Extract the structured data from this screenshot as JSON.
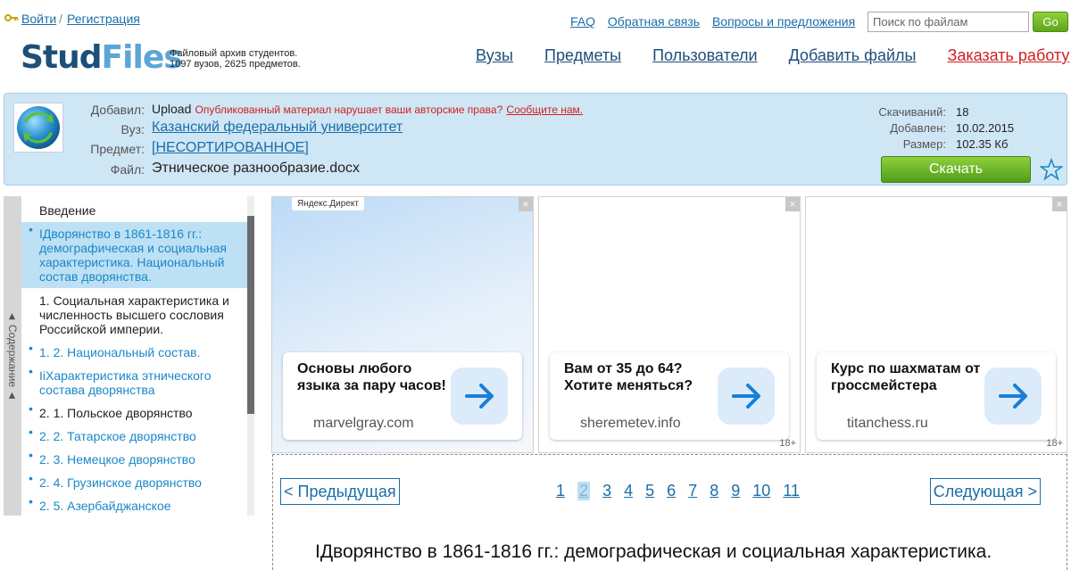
{
  "auth": {
    "login": "Войти",
    "separator": "/",
    "register": "Регистрация"
  },
  "top_links": [
    "FAQ",
    "Обратная связь",
    "Вопросы и предложения"
  ],
  "search": {
    "placeholder": "Поиск по файлам",
    "button": "Go"
  },
  "logo": {
    "part1": "Stud",
    "part2": "Files"
  },
  "tagline": {
    "line1": "Файловый архив студентов.",
    "line2": "1097 вузов, 2625 предметов."
  },
  "nav": {
    "universities": "Вузы",
    "subjects": "Предметы",
    "users": "Пользователи",
    "add_files": "Добавить файлы",
    "order": "Заказать работу"
  },
  "info": {
    "added_label": "Добавил:",
    "uploader": "Upload",
    "claim_text": "Опубликованный материал нарушает ваши авторские права?",
    "claim_link": "Сообщите нам.",
    "university_label": "Вуз:",
    "university": "Казанский федеральный университет",
    "subject_label": "Предмет:",
    "subject": "[НЕСОРТИРОВАННОЕ]",
    "file_label": "Файл:",
    "file": "Этническое разнообразие.docx"
  },
  "stats": {
    "downloads_label": "Скачиваний:",
    "downloads": "18",
    "added_label": "Добавлен:",
    "added": "10.02.2015",
    "size_label": "Размер:",
    "size": "102.35 Кб",
    "download_button": "Скачать"
  },
  "toc": {
    "tab_label": "◄ Содержание ◄",
    "items": [
      {
        "text": "Введение"
      },
      {
        "text": "IДворянство в 1861-1816 гг.: демографическая и социальная характеристика. Национальный состав дворянства."
      },
      {
        "text": "1. Социальная характеристика и численность высшего сословия Российской империи."
      },
      {
        "text": "1. 2. Национальный состав."
      },
      {
        "text": "IiХарактеристика этнического состава дворянства"
      },
      {
        "text": "2. 1. Польское дворянство"
      },
      {
        "text": "2. 2. Татарское дворянство"
      },
      {
        "text": "2. 3. Немецкое дворянство"
      },
      {
        "text": "2. 4. Грузинское дворянство"
      },
      {
        "text": "2. 5. Азербайджанское"
      }
    ]
  },
  "ads": [
    {
      "label": "Яндекс.Директ",
      "title": "Основы любого языка за пару часов!",
      "domain": "marvelgray.com",
      "age": ""
    },
    {
      "label": "",
      "title": "Вам от 35 до 64? Хотите меняться?",
      "domain": "sheremetev.info",
      "age": "18+"
    },
    {
      "label": "",
      "title": "Курс по шахматам от гроссмейстера",
      "domain": "titanchess.ru",
      "age": "18+"
    }
  ],
  "ad_close": "×",
  "pagination": {
    "prev": "< Предыдущая",
    "next": "Следующая >",
    "pages": [
      "1",
      "2",
      "3",
      "4",
      "5",
      "6",
      "7",
      "8",
      "9",
      "10",
      "11"
    ],
    "current": "2"
  },
  "document": {
    "heading": "IДворянство в 1861-1816 гг.: демографическая и социальная характеристика."
  },
  "colors": {
    "accent": "#1a6ea8",
    "order": "#d21f1f",
    "panel": "#cfe6f5",
    "download": "#5fa51c"
  }
}
